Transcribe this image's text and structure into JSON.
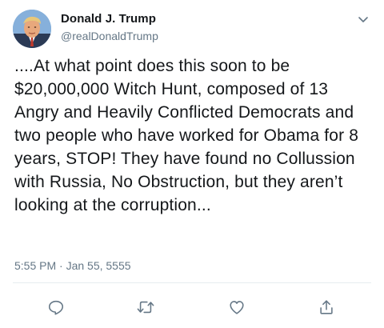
{
  "author": {
    "name": "Donald J. Trump",
    "handle": "@realDonaldTrump"
  },
  "tweet": {
    "text": "....At what point does this soon to be $20,000,000 Witch Hunt, composed of 13 Angry and Heavily Conflicted Democrats and two people who have worked for Obama for 8 years, STOP! They have found no Collussion with Russia, No Obstruction, but they aren’t looking at the corruption...",
    "timestamp": "5:55 PM · Jan 55, 5555"
  },
  "icons": {
    "menu": "chevron-down-icon",
    "reply": "reply-icon",
    "retweet": "retweet-icon",
    "like": "heart-icon",
    "share": "share-icon"
  },
  "colors": {
    "text": "#14171a",
    "secondary": "#657786",
    "icon": "#657786",
    "divider": "#e6ecf0"
  }
}
